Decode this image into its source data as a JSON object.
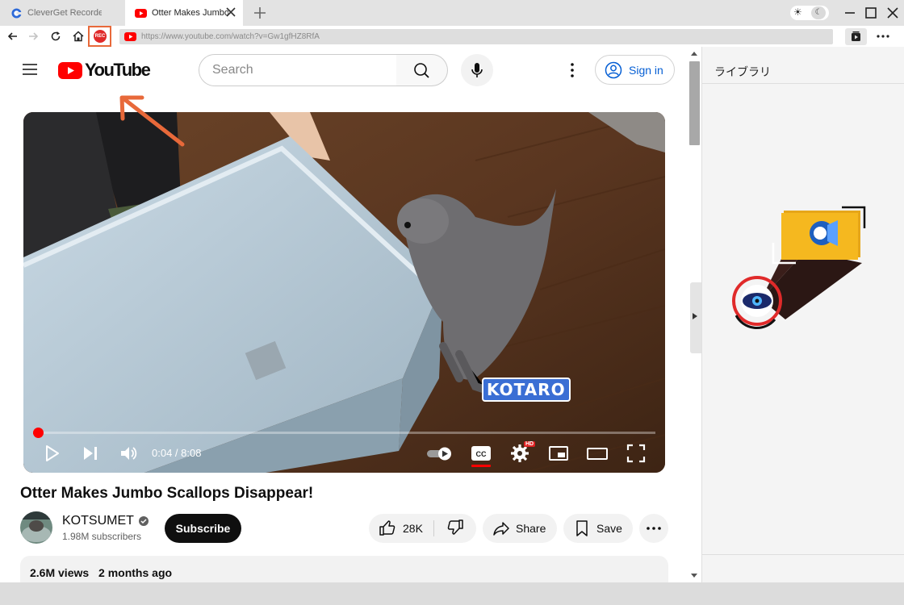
{
  "browser": {
    "tabs": [
      {
        "label": "CleverGet Recorder",
        "active": false
      },
      {
        "label": "Otter Makes Jumbo Scallops Disappear!",
        "active": true
      }
    ],
    "url": "https://www.youtube.com/watch?v=Gw1gfHZ8RfA",
    "rec_label": "REC",
    "theme_icons": {
      "light": "☀",
      "dark": "☾"
    }
  },
  "youtube": {
    "logo_text": "YouTube",
    "search_placeholder": "Search",
    "sign_in_label": "Sign in",
    "player": {
      "watermark": "KOTARO",
      "time_display": "0:04 / 8:08",
      "progress": 0.008,
      "hd_badge": "HD"
    },
    "video_title": "Otter Makes Jumbo Scallops Disappear!",
    "channel": {
      "name": "KOTSUMET",
      "subscribers": "1.98M subscribers",
      "subscribe_label": "Subscribe"
    },
    "actions": {
      "like_count": "28K",
      "share_label": "Share",
      "save_label": "Save"
    },
    "description": {
      "views": "2.6M views",
      "age": "2 months ago"
    }
  },
  "library": {
    "title": "ライブラリ"
  },
  "colors": {
    "accent_orange": "#e8693a",
    "youtube_red": "#ff0000",
    "link_blue": "#065fd4"
  }
}
